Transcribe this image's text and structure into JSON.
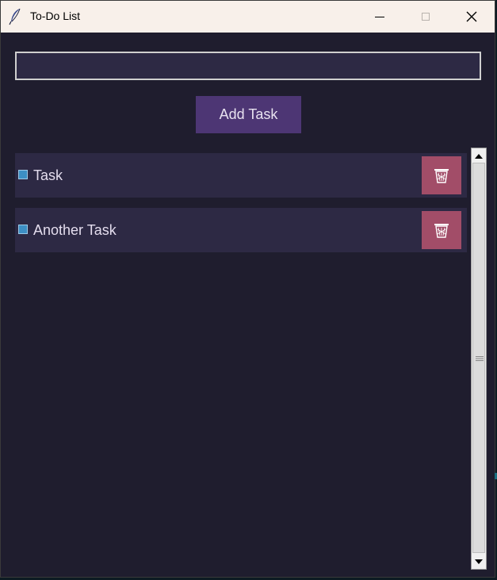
{
  "window": {
    "title": "To-Do List",
    "icon": "feather-icon",
    "controls": [
      "minimize-icon",
      "maximize-icon",
      "close-icon"
    ]
  },
  "input": {
    "value": "",
    "placeholder": ""
  },
  "add_button": {
    "label": "Add Task"
  },
  "tasks": [
    {
      "label": "Task",
      "checked": false
    },
    {
      "label": "Another Task",
      "checked": false
    }
  ],
  "colors": {
    "background": "#1f1d2e",
    "row": "#2d2944",
    "add_button": "#4d3674",
    "delete_button": "#a24d68",
    "checkbox": "#3d8fc4",
    "titlebar": "#f8f0ea"
  }
}
